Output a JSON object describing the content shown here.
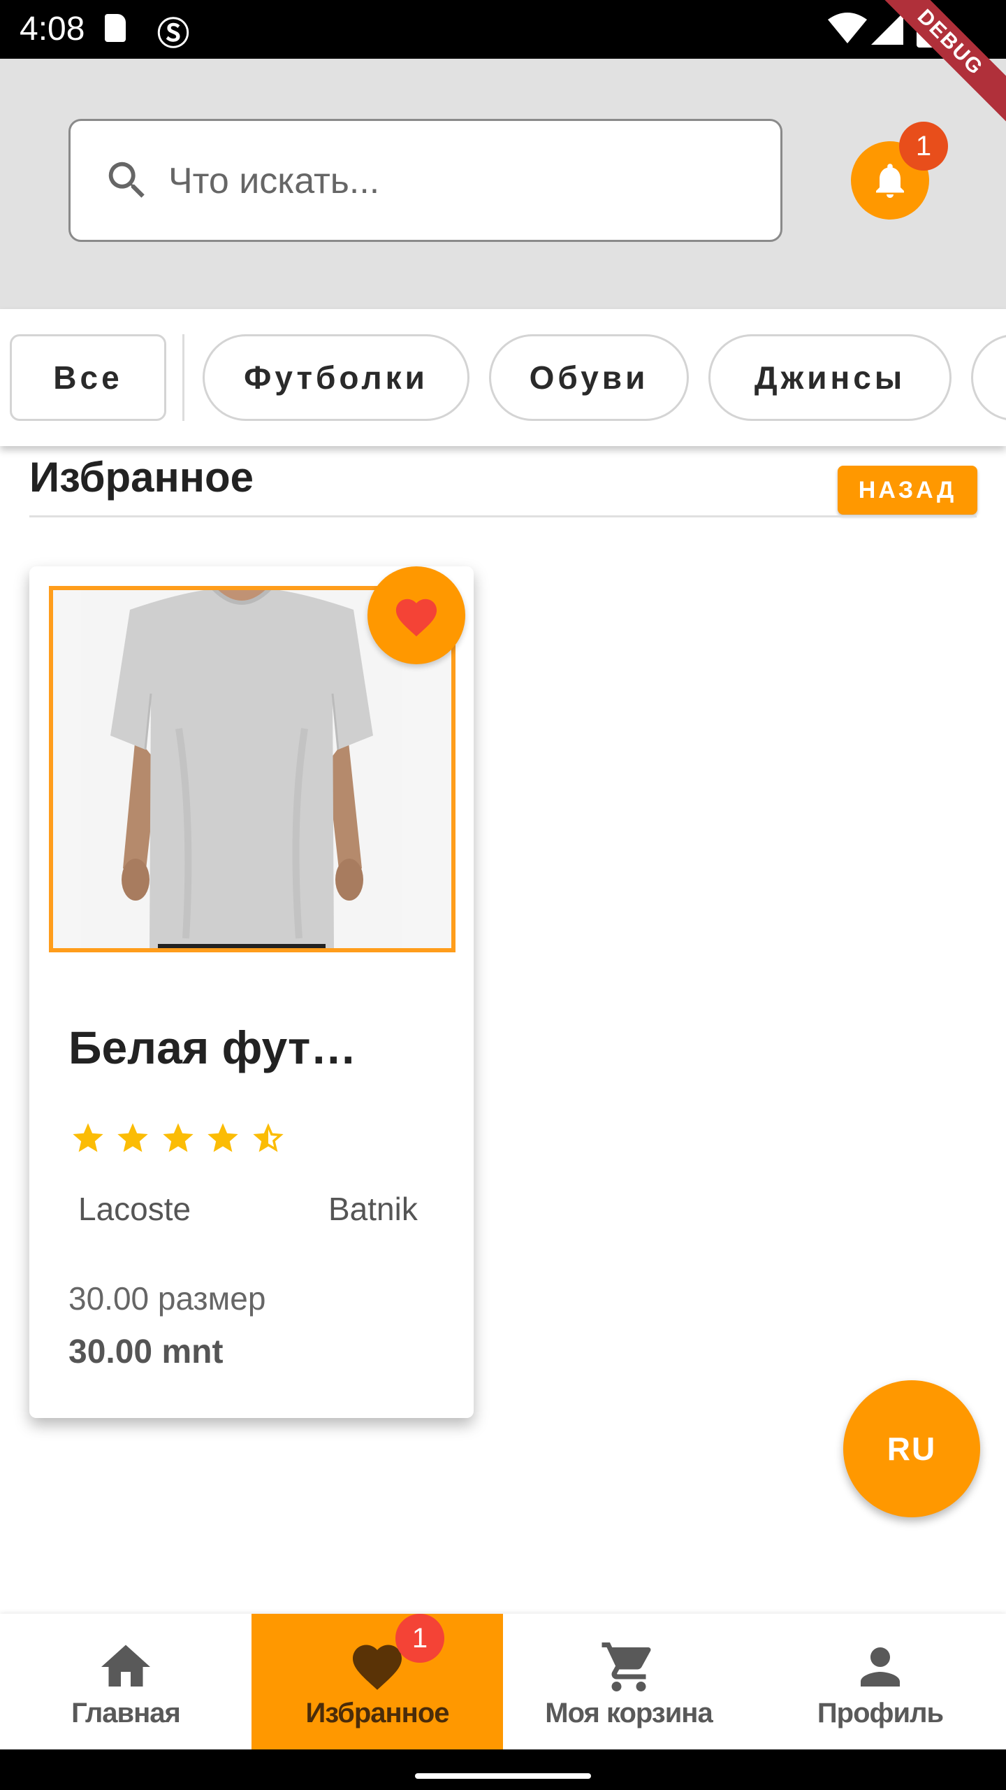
{
  "status_bar": {
    "time": "4:08",
    "debug_label": "DEBUG",
    "icons": [
      "sd-card-icon",
      "s-icon",
      "wifi-icon",
      "signal-icon",
      "battery-icon"
    ]
  },
  "header": {
    "search": {
      "placeholder": "Что искать...",
      "value": ""
    },
    "notification_count": "1"
  },
  "categories": [
    "Все",
    "Футболки",
    "Обуви",
    "Джинсы"
  ],
  "section": {
    "title": "Избранное",
    "back_label": "НАЗАД"
  },
  "products": [
    {
      "title": "Белая фут…",
      "rating": 4.5,
      "brand": "Lacoste",
      "category": "Batnik",
      "size": "30.00 размер",
      "price": "30.00 mnt",
      "favorite": true
    }
  ],
  "language_button": "RU",
  "bottom_nav": {
    "items": [
      {
        "label": "Главная",
        "icon": "home-icon"
      },
      {
        "label": "Избранное",
        "icon": "heart-icon",
        "badge": "1",
        "active": true
      },
      {
        "label": "Моя корзина",
        "icon": "cart-icon"
      },
      {
        "label": "Профиль",
        "icon": "person-icon"
      }
    ]
  },
  "colors": {
    "accent": "#ff9800",
    "badge": "#f44336",
    "heart": "#f44336",
    "star": "#fbbc05",
    "header_bg": "#e1e1e1"
  }
}
